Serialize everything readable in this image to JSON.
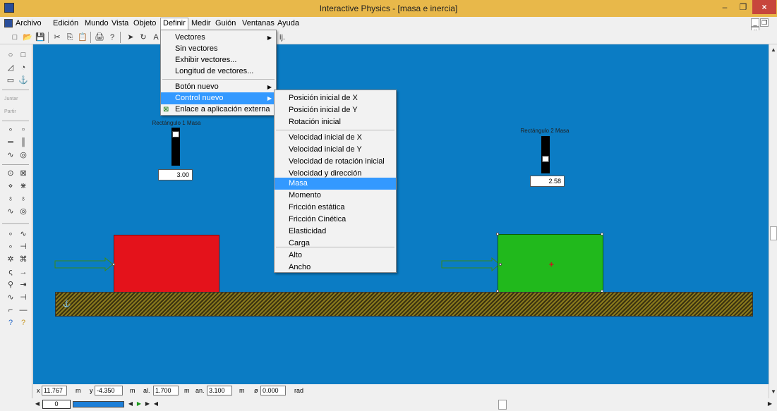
{
  "window": {
    "title": "Interactive Physics - [masa e inercia]",
    "min": "–",
    "max": "❐",
    "close": "×"
  },
  "menubar": [
    "Archivo",
    "Edición",
    "Mundo",
    "Vista",
    "Objeto",
    "Definir",
    "Medir",
    "Guión",
    "Ventanas",
    "Ayuda"
  ],
  "mdi_buttons": [
    "_",
    "❐",
    "×"
  ],
  "toolbar": {
    "icons": [
      "□",
      "📂",
      "💾",
      "✂",
      "⎘",
      "📋",
      "🖨",
      "?",
      "➤",
      "↻",
      "A"
    ],
    "partial_label": "ij."
  },
  "left_toolbar": {
    "row1": [
      "○",
      "□"
    ],
    "row2": [
      "◿",
      "◔"
    ],
    "row3": [
      "▭",
      "⚓"
    ],
    "juntar": "Juntar",
    "partir": "Partir",
    "row4": [
      "∘",
      "▫"
    ],
    "row5": [
      "═",
      "║"
    ],
    "row6": [
      "∿",
      "◎"
    ],
    "row7": [
      "⊙",
      "⊠"
    ],
    "row8": [
      "⋄",
      "⋇"
    ],
    "row9": [
      "♁",
      "♁"
    ],
    "row10": [
      "∿",
      "◎"
    ],
    "row11": [
      "∘",
      "∿"
    ],
    "row12": [
      "∘",
      "⊣"
    ],
    "row13": [
      "✲",
      "⌘"
    ],
    "row14": [
      "ς",
      "→"
    ],
    "row15": [
      "⚲",
      "⇥"
    ],
    "row16": [
      "∿",
      "⊣"
    ],
    "row17": [
      "⌐",
      "—"
    ],
    "row18": [
      "?",
      "?"
    ]
  },
  "sliders": [
    {
      "label": "Rectángulo 1 Masa",
      "value": "3.00",
      "level": 0.9
    },
    {
      "label": "Rectángulo 2 Masa",
      "value": "2.58",
      "level": 0.35
    }
  ],
  "definir_menu": {
    "items": [
      {
        "label": "Vectores",
        "submenu": true
      },
      {
        "label": "Sin vectores"
      },
      {
        "label": "Exhibir vectores..."
      },
      {
        "label": "Longitud de vectores..."
      },
      {
        "label": "Botón nuevo",
        "submenu": true
      },
      {
        "label": "Control nuevo",
        "submenu": true,
        "highlighted": true
      },
      {
        "label": "Enlace a aplicación externa"
      }
    ]
  },
  "control_nuevo_submenu": {
    "items": [
      "Posición inicial de X",
      "Posición inicial de Y",
      "Rotación inicial",
      "Velocidad inicial de X",
      "Velocidad inicial de Y",
      "Velocidad de rotación inicial",
      "Velocidad y dirección",
      "Masa",
      "Momento",
      "Fricción estática",
      "Fricción Cinética",
      "Elasticidad",
      "Carga",
      "Alto",
      "Ancho"
    ],
    "highlighted": "Masa"
  },
  "statusbar": {
    "x_label": "x",
    "x": "11.767",
    "x_unit": "m",
    "y_label": "y",
    "y": "-4.350",
    "y_unit": "m",
    "al_label": "al.",
    "al": "1.700",
    "al_unit": "m",
    "an_label": "an.",
    "an": "3.100",
    "an_unit": "m",
    "rot_label": "ø",
    "rot": "0.000",
    "rot_unit": "rad"
  },
  "playback": {
    "frame": "0"
  },
  "colors": {
    "workspace": "#0b7cc4",
    "rect1": "#e4121b",
    "rect2": "#21b91c",
    "highlight": "#3399ff"
  }
}
